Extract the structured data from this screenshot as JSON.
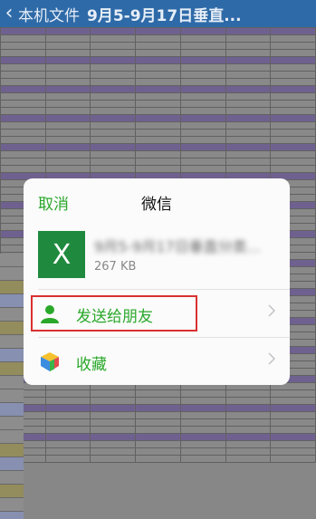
{
  "nav": {
    "back_label": "本机文件",
    "title": "9月5-9月17日垂直..."
  },
  "share_sheet": {
    "cancel_label": "取消",
    "title": "微信",
    "file": {
      "icon_letter": "X",
      "name": "9月5-9月17日垂直分类...",
      "size": "267 KB"
    },
    "actions": [
      {
        "label": "发送给朋友",
        "icon": "contact-icon",
        "highlighted": true
      },
      {
        "label": "收藏",
        "icon": "favorites-cube-icon",
        "highlighted": false
      }
    ]
  },
  "colors": {
    "nav_bg": "#2e6aa8",
    "wechat_green": "#2aa82a",
    "highlight_red": "#d93030",
    "excel_green": "#1f8a3e"
  }
}
